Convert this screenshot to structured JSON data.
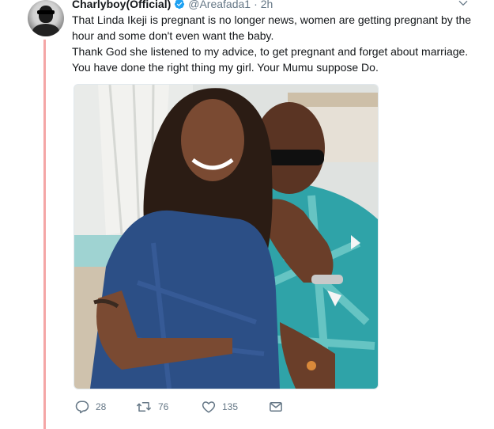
{
  "tweet": {
    "author_name": "Charlyboy(Official)",
    "handle": "@Areafada1",
    "separator": "·",
    "time": "2h",
    "verified_icon": "verified-badge-icon",
    "verified_color": "#1da1f2",
    "text_lines": [
      "That Linda Ikeji is pregnant is no longer news, women are getting pregnant by the hour and some don't even want the baby.",
      "Thank God she listened to my advice, to get pregnant and forget about marriage. You have done the right thing my girl. Your Mumu suppose Do."
    ]
  },
  "actions": {
    "reply_count": "28",
    "retweet_count": "76",
    "like_count": "135",
    "icons": [
      "reply-icon",
      "retweet-icon",
      "like-icon",
      "message-icon"
    ]
  },
  "colors": {
    "thread_line": "#f4a6a6",
    "secondary_text": "#657786",
    "primary_text": "#14171a"
  }
}
